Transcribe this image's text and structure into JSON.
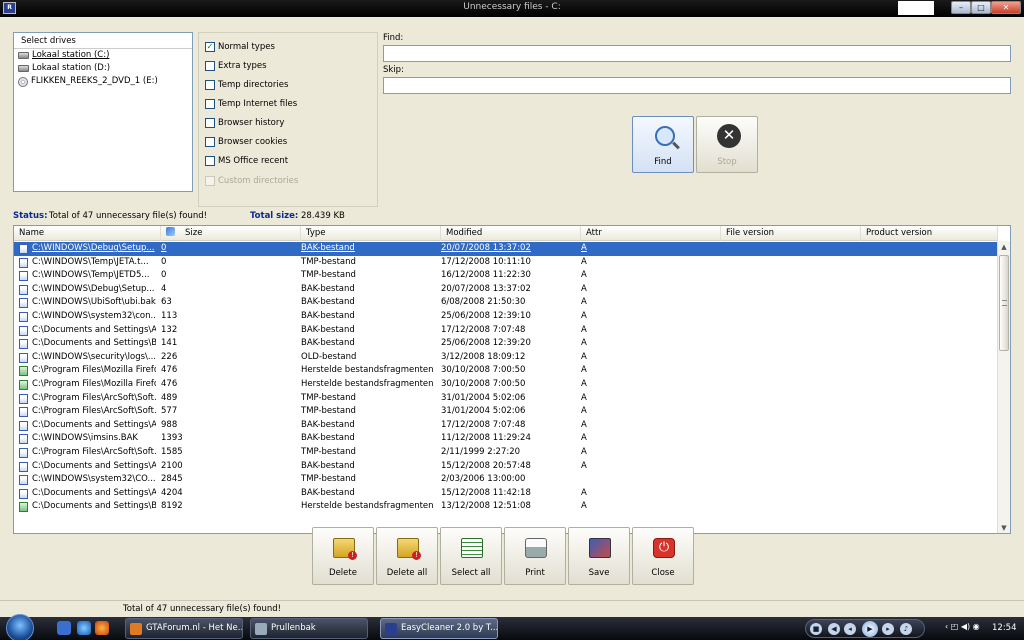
{
  "titlebar": {
    "title": "Unnecessary files - C:",
    "app_icon_text": "R",
    "min": "–",
    "max": "□",
    "close": "✕"
  },
  "drives": {
    "header": "Select drives",
    "items": [
      {
        "label": "Lokaal station (C:)",
        "kind": "hdd",
        "selected": true
      },
      {
        "label": "Lokaal station (D:)",
        "kind": "hdd",
        "selected": false
      },
      {
        "label": "FLIKKEN_REEKS_2_DVD_1 (E:)",
        "kind": "cd",
        "selected": false
      }
    ]
  },
  "types": [
    {
      "label": "Normal types",
      "checked": true,
      "disabled": false
    },
    {
      "label": "Extra types",
      "checked": false,
      "disabled": false
    },
    {
      "label": "Temp directories",
      "checked": false,
      "disabled": false
    },
    {
      "label": "Temp Internet files",
      "checked": false,
      "disabled": false
    },
    {
      "label": "Browser history",
      "checked": false,
      "disabled": false
    },
    {
      "label": "Browser cookies",
      "checked": false,
      "disabled": false
    },
    {
      "label": "MS Office recent",
      "checked": false,
      "disabled": false
    },
    {
      "label": "Custom directories",
      "checked": false,
      "disabled": true
    }
  ],
  "search": {
    "find_label": "Find:",
    "find_value": "",
    "skip_label": "Skip:",
    "skip_value": ""
  },
  "buttons": {
    "find": "Find",
    "stop": "Stop",
    "delete": "Delete",
    "delete_all": "Delete all",
    "select_all": "Select all",
    "print": "Print",
    "save": "Save",
    "close": "Close"
  },
  "status": {
    "label": "Status:",
    "text": "Total of 47 unnecessary file(s) found!",
    "total_label": "Total size:",
    "total_value": "28.439 KB"
  },
  "list": {
    "columns": [
      "Name",
      "Size",
      "Type",
      "Modified",
      "Attr",
      "File version",
      "Product version"
    ],
    "rows": [
      {
        "name": "C:\\WINDOWS\\Debug\\Setup...",
        "size": "0",
        "type": "BAK-bestand",
        "modified": "20/07/2008 13:37:02",
        "attr": "A",
        "icon": "file"
      },
      {
        "name": "C:\\WINDOWS\\Temp\\JETA.t...",
        "size": "0",
        "type": "TMP-bestand",
        "modified": "17/12/2008 10:11:10",
        "attr": "A",
        "icon": "file"
      },
      {
        "name": "C:\\WINDOWS\\Temp\\JETD5...",
        "size": "0",
        "type": "TMP-bestand",
        "modified": "16/12/2008 11:22:30",
        "attr": "A",
        "icon": "file"
      },
      {
        "name": "C:\\WINDOWS\\Debug\\Setup...",
        "size": "4",
        "type": "BAK-bestand",
        "modified": "20/07/2008 13:37:02",
        "attr": "A",
        "icon": "file"
      },
      {
        "name": "C:\\WINDOWS\\UbiSoft\\ubi.bak",
        "size": "63",
        "type": "BAK-bestand",
        "modified": "6/08/2008 21:50:30",
        "attr": "A",
        "icon": "file"
      },
      {
        "name": "C:\\WINDOWS\\system32\\con...",
        "size": "113",
        "type": "BAK-bestand",
        "modified": "25/06/2008 12:39:10",
        "attr": "A",
        "icon": "file"
      },
      {
        "name": "C:\\Documents and Settings\\A...",
        "size": "132",
        "type": "BAK-bestand",
        "modified": "17/12/2008 7:07:48",
        "attr": "A",
        "icon": "file"
      },
      {
        "name": "C:\\Documents and Settings\\B...",
        "size": "141",
        "type": "BAK-bestand",
        "modified": "25/06/2008 12:39:20",
        "attr": "A",
        "icon": "file"
      },
      {
        "name": "C:\\WINDOWS\\security\\logs\\...",
        "size": "226",
        "type": "OLD-bestand",
        "modified": "3/12/2008 18:09:12",
        "attr": "A",
        "icon": "file"
      },
      {
        "name": "C:\\Program Files\\Mozilla Firefo...",
        "size": "476",
        "type": "Herstelde bestandsfragmenten",
        "modified": "30/10/2008 7:00:50",
        "attr": "A",
        "icon": "shortcut"
      },
      {
        "name": "C:\\Program Files\\Mozilla Firefo...",
        "size": "476",
        "type": "Herstelde bestandsfragmenten",
        "modified": "30/10/2008 7:00:50",
        "attr": "A",
        "icon": "shortcut"
      },
      {
        "name": "C:\\Program Files\\ArcSoft\\Soft...",
        "size": "489",
        "type": "TMP-bestand",
        "modified": "31/01/2004 5:02:06",
        "attr": "A",
        "icon": "file"
      },
      {
        "name": "C:\\Program Files\\ArcSoft\\Soft...",
        "size": "577",
        "type": "TMP-bestand",
        "modified": "31/01/2004 5:02:06",
        "attr": "A",
        "icon": "file"
      },
      {
        "name": "C:\\Documents and Settings\\A...",
        "size": "988",
        "type": "BAK-bestand",
        "modified": "17/12/2008 7:07:48",
        "attr": "A",
        "icon": "file"
      },
      {
        "name": "C:\\WINDOWS\\imsins.BAK",
        "size": "1393",
        "type": "BAK-bestand",
        "modified": "11/12/2008 11:29:24",
        "attr": "A",
        "icon": "file"
      },
      {
        "name": "C:\\Program Files\\ArcSoft\\Soft...",
        "size": "1585",
        "type": "TMP-bestand",
        "modified": "2/11/1999 2:27:20",
        "attr": "A",
        "icon": "file"
      },
      {
        "name": "C:\\Documents and Settings\\A...",
        "size": "2100",
        "type": "BAK-bestand",
        "modified": "15/12/2008 20:57:48",
        "attr": "A",
        "icon": "file"
      },
      {
        "name": "C:\\WINDOWS\\system32\\CO...",
        "size": "2845",
        "type": "TMP-bestand",
        "modified": "2/03/2006 13:00:00",
        "attr": "",
        "icon": "file"
      },
      {
        "name": "C:\\Documents and Settings\\A...",
        "size": "4204",
        "type": "BAK-bestand",
        "modified": "15/12/2008 11:42:18",
        "attr": "A",
        "icon": "file"
      },
      {
        "name": "C:\\Documents and Settings\\B...",
        "size": "8192",
        "type": "Herstelde bestandsfragmenten",
        "modified": "13/12/2008 12:51:08",
        "attr": "A",
        "icon": "shortcut"
      }
    ]
  },
  "statusbar": {
    "text": "Total of 47 unnecessary file(s) found!"
  },
  "taskbar": {
    "tasks": [
      {
        "label": "GTAForum.nl - Het Ne...",
        "active": false
      },
      {
        "label": "Prullenbak",
        "active": false
      },
      {
        "label": "EasyCleaner 2.0 by T...",
        "active": true
      }
    ],
    "tray_text": "‹ ◰ ◀) ◉",
    "clock": "12:54"
  },
  "colors": {
    "window_bg": "#ece9d8",
    "selection": "#316ac5",
    "status_label": "#0a2a90",
    "taskbar": "#07090d"
  }
}
